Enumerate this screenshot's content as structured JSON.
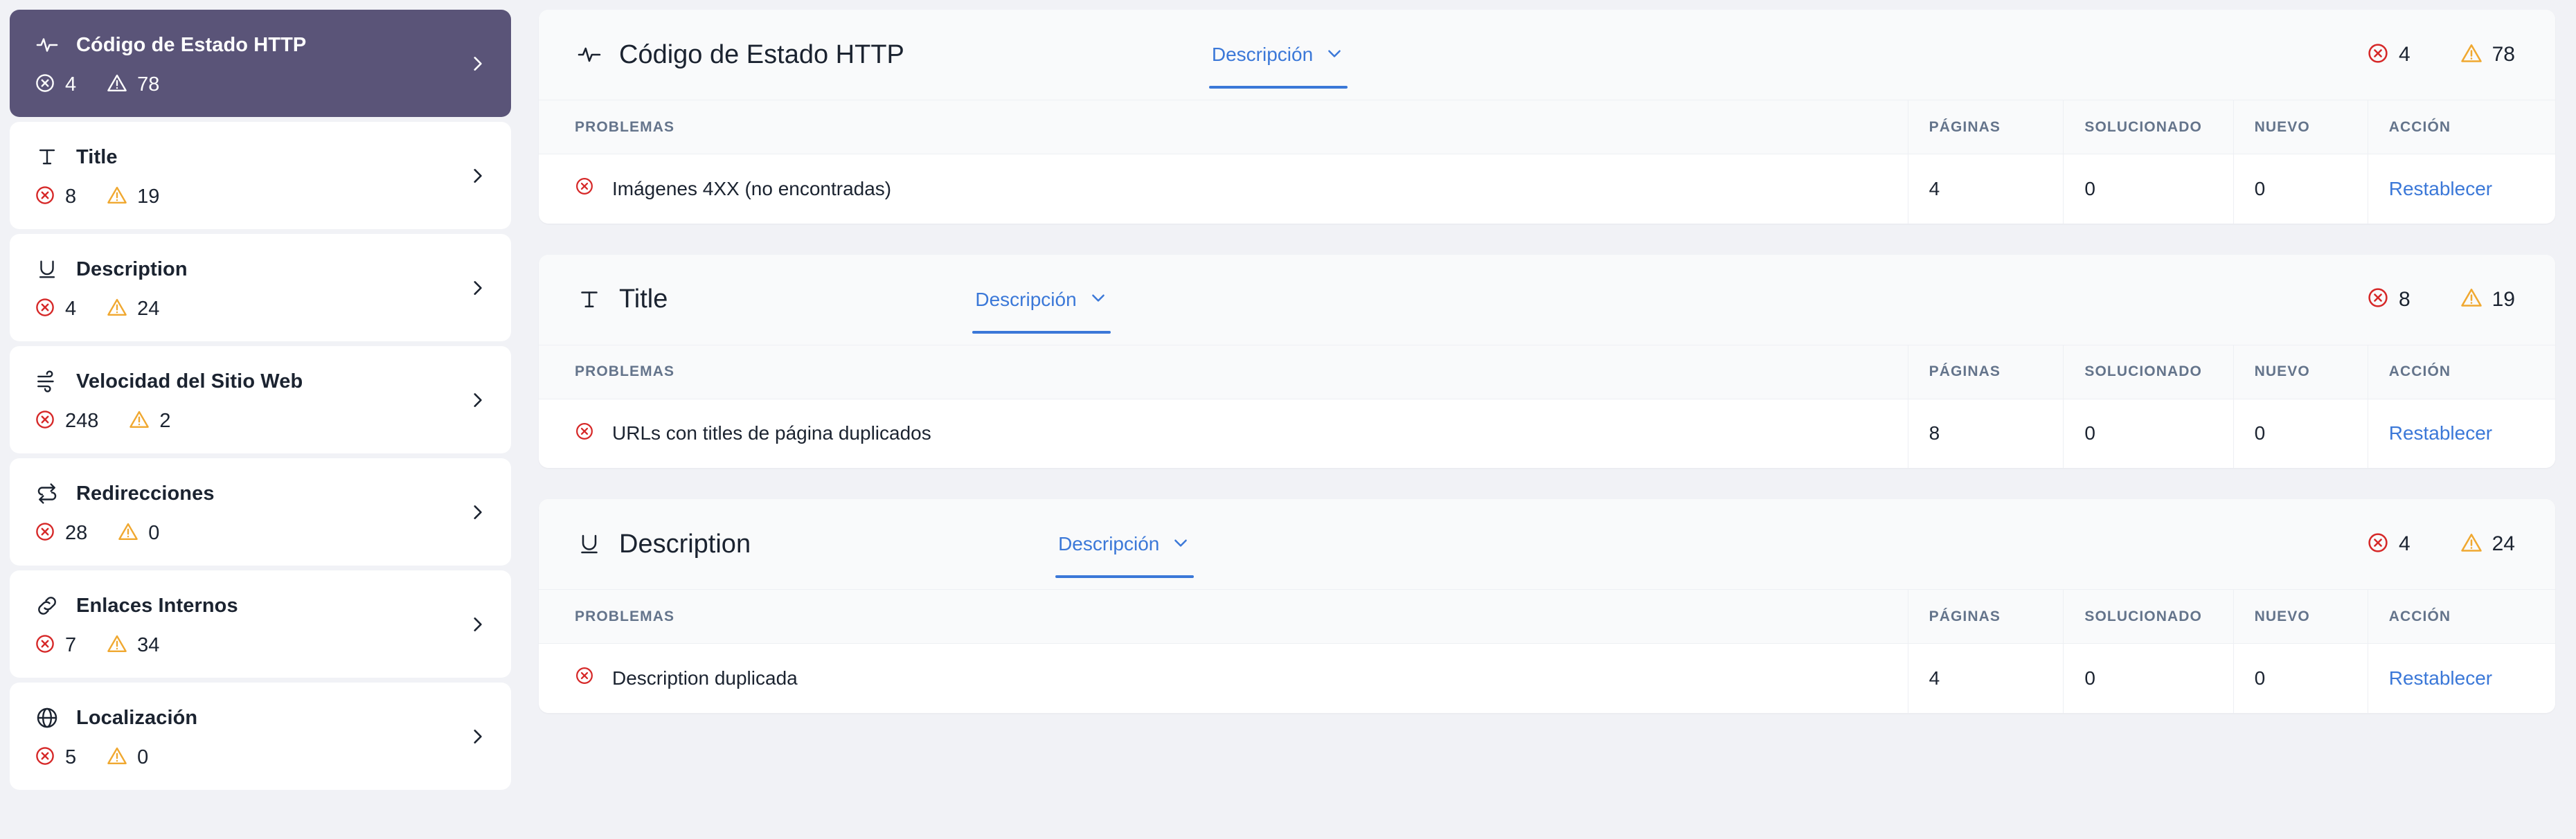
{
  "colors": {
    "active_card_bg": "#5A5478",
    "error_red": "#D62828",
    "warning_amber": "#F0A830",
    "link_blue": "#3B78D8",
    "page_bg": "#F1F2F6"
  },
  "sidebar": {
    "items": [
      {
        "icon": "activity-pulse-icon",
        "label": "Código de Estado HTTP",
        "errors": "4",
        "warnings": "78",
        "active": true
      },
      {
        "icon": "title-text-icon",
        "label": "Title",
        "errors": "8",
        "warnings": "19",
        "active": false
      },
      {
        "icon": "underline-icon",
        "label": "Description",
        "errors": "4",
        "warnings": "24",
        "active": false
      },
      {
        "icon": "wind-speed-icon",
        "label": "Velocidad del Sitio Web",
        "errors": "248",
        "warnings": "2",
        "active": false
      },
      {
        "icon": "redirect-arrows-icon",
        "label": "Redirecciones",
        "errors": "28",
        "warnings": "0",
        "active": false
      },
      {
        "icon": "link-chain-icon",
        "label": "Enlaces Internos",
        "errors": "7",
        "warnings": "34",
        "active": false
      },
      {
        "icon": "globe-icon",
        "label": "Localización",
        "errors": "5",
        "warnings": "0",
        "active": false
      }
    ]
  },
  "main": {
    "columns": [
      "PROBLEMAS",
      "PÁGINAS",
      "SOLUCIONADO",
      "NUEVO",
      "ACCIÓN"
    ],
    "tab_label": "Descripción",
    "panels": [
      {
        "icon": "activity-pulse-icon",
        "title": "Código de Estado HTTP",
        "errors": "4",
        "warnings": "78",
        "rows": [
          {
            "problem": "Imágenes 4XX (no encontradas)",
            "paginas": "4",
            "solucionado": "0",
            "nuevo": "0",
            "accion": "Restablecer"
          }
        ]
      },
      {
        "icon": "title-text-icon",
        "title": "Title",
        "errors": "8",
        "warnings": "19",
        "rows": [
          {
            "problem": "URLs con titles de página duplicados",
            "paginas": "8",
            "solucionado": "0",
            "nuevo": "0",
            "accion": "Restablecer"
          }
        ]
      },
      {
        "icon": "underline-icon",
        "title": "Description",
        "errors": "4",
        "warnings": "24",
        "rows": [
          {
            "problem": "Description duplicada",
            "paginas": "4",
            "solucionado": "0",
            "nuevo": "0",
            "accion": "Restablecer"
          }
        ]
      }
    ]
  }
}
